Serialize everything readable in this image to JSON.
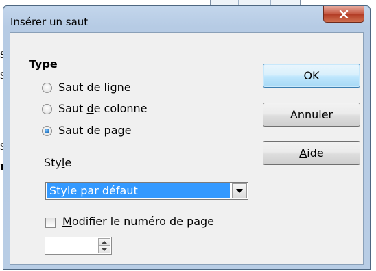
{
  "background": {
    "text_fragments": [
      "s",
      "s",
      "s",
      "r"
    ]
  },
  "dialog": {
    "title": "Insérer un saut",
    "close_icon": "close-icon",
    "type_section": {
      "title": "Type",
      "options": [
        {
          "label_before": "",
          "underline": "S",
          "label_after": "aut de ligne",
          "checked": false
        },
        {
          "label_before": "Saut ",
          "underline": "d",
          "label_after": "e colonne",
          "checked": false
        },
        {
          "label_before": "Saut de ",
          "underline": "p",
          "label_after": "age",
          "checked": true
        }
      ]
    },
    "style": {
      "label_before": "Sty",
      "label_underline": "l",
      "label_after": "e",
      "selected_value": "Style par défaut"
    },
    "modify_page_number": {
      "label_underline": "M",
      "label_after": "odifier le numéro de page",
      "checked": false,
      "value": ""
    },
    "buttons": {
      "ok": "OK",
      "cancel": "Annuler",
      "help_underline": "A",
      "help_after": "ide"
    }
  }
}
